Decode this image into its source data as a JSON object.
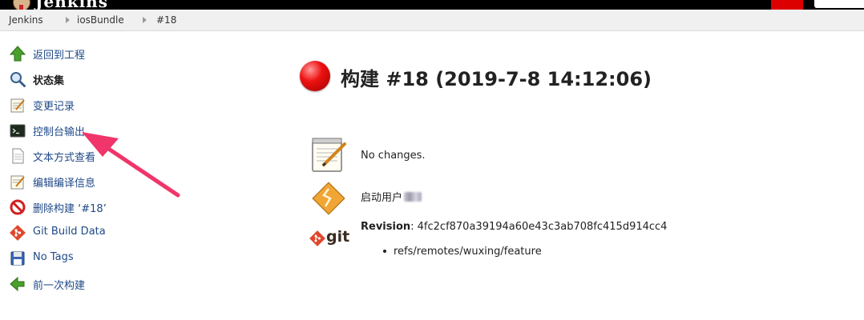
{
  "header": {
    "logo_text": "Jenkins"
  },
  "breadcrumb": {
    "items": [
      "Jenkins",
      "iosBundle",
      "#18"
    ]
  },
  "sidebar": {
    "items": [
      {
        "label": "返回到工程",
        "icon": "up-arrow-icon"
      },
      {
        "label": "状态集",
        "icon": "search-icon"
      },
      {
        "label": "变更记录",
        "icon": "notepad-icon"
      },
      {
        "label": "控制台输出",
        "icon": "terminal-icon"
      },
      {
        "label": "文本方式查看",
        "icon": "document-icon"
      },
      {
        "label": "编辑编译信息",
        "icon": "notepad-edit-icon"
      },
      {
        "label": "删除构建 ‘#18’",
        "icon": "no-entry-icon"
      },
      {
        "label": "Git Build Data",
        "icon": "git-icon"
      },
      {
        "label": "No Tags",
        "icon": "floppy-disk-icon"
      },
      {
        "label": "前一次构建",
        "icon": "left-arrow-icon"
      }
    ]
  },
  "main": {
    "title": "构建 #18 (2019-7-8 14:12:06)",
    "status_color": "#ee1111",
    "changes_text": "No changes.",
    "started_by": "启动用户",
    "revision_label": "Revision",
    "revision_value": ": 4fc2cf870a39194a60e43c3ab708fc415d914cc4",
    "branch": "refs/remotes/wuxing/feature",
    "git_logo_text": "git"
  },
  "colors": {
    "link": "#204a87",
    "annotation": "#f0356a",
    "header": "#000000"
  }
}
